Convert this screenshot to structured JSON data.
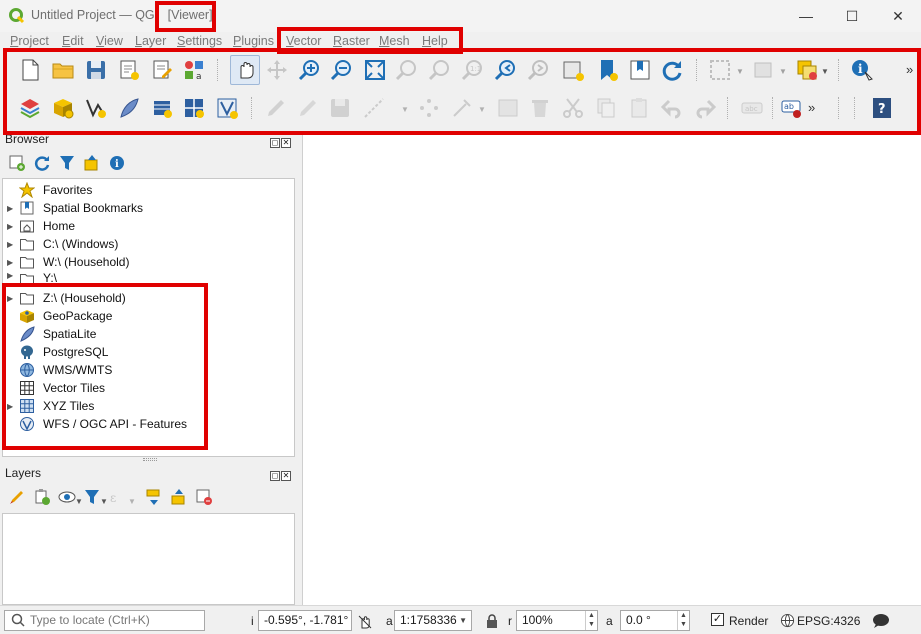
{
  "window": {
    "title": "Untitled Project — QGI",
    "title_suffix": "[Viewer]",
    "minimize": "—",
    "maximize": "☐",
    "close": "✕"
  },
  "menu": [
    {
      "label": "Project",
      "mn": "P",
      "rest": "roject"
    },
    {
      "label": "Edit",
      "mn": "E",
      "rest": "dit"
    },
    {
      "label": "View",
      "mn": "V",
      "rest": "iew"
    },
    {
      "label": "Layer",
      "mn": "L",
      "rest": "ayer"
    },
    {
      "label": "Settings",
      "mn": "S",
      "rest": "ettings"
    },
    {
      "label": "Plugins",
      "mn": "P",
      "rest": "lugins"
    },
    {
      "label": "Vector",
      "mn": "V",
      "rest": "ector"
    },
    {
      "label": "Raster",
      "mn": "R",
      "rest": "aster"
    },
    {
      "label": "Mesh",
      "mn": "M",
      "rest": "esh"
    },
    {
      "label": "Help",
      "mn": "H",
      "rest": "elp"
    }
  ],
  "toolbar": {
    "overflow_label": "»"
  },
  "browser": {
    "title": "Browser",
    "items": [
      {
        "label": "Favorites",
        "icon": "star-icon",
        "expandable": false
      },
      {
        "label": "Spatial Bookmarks",
        "icon": "bookmark-icon",
        "expandable": true
      },
      {
        "label": "Home",
        "icon": "home-folder-icon",
        "expandable": true
      },
      {
        "label": "C:\\ (Windows)",
        "icon": "folder-icon",
        "expandable": true
      },
      {
        "label": "W:\\ (Household)",
        "icon": "folder-icon",
        "expandable": true
      },
      {
        "label": "Y:\\",
        "icon": "folder-icon",
        "expandable": true
      },
      {
        "label": "Z:\\ (Household)",
        "icon": "folder-icon",
        "expandable": true
      },
      {
        "label": "GeoPackage",
        "icon": "geopackage-icon",
        "expandable": false
      },
      {
        "label": "SpatiaLite",
        "icon": "spatialite-feather-icon",
        "expandable": false
      },
      {
        "label": "PostgreSQL",
        "icon": "postgresql-elephant-icon",
        "expandable": false
      },
      {
        "label": "WMS/WMTS",
        "icon": "globe-icon",
        "expandable": false
      },
      {
        "label": "Vector Tiles",
        "icon": "vector-tiles-grid-icon",
        "expandable": false
      },
      {
        "label": "XYZ Tiles",
        "icon": "xyz-tiles-grid-icon",
        "expandable": true
      },
      {
        "label": "WFS / OGC API - Features",
        "icon": "wfs-icon",
        "expandable": false
      }
    ]
  },
  "layers": {
    "title": "Layers"
  },
  "status": {
    "locate_placeholder": "Type to locate (Ctrl+K)",
    "coordinate_label": "i",
    "coordinate": "-0.595°, -1.781°",
    "scale_label": "a",
    "scale": "1:1758336",
    "magnifier_label": "r",
    "magnifier": "100%",
    "rotation_label": "a",
    "rotation": "0.0 °",
    "render_label": "Render",
    "crs": "EPSG:4326"
  },
  "colors": {
    "highlight_red": "#e00000",
    "qgis_green": "#5ca832",
    "qgis_yellow": "#f5c400",
    "toolbar_blue": "#1f6fb5"
  }
}
